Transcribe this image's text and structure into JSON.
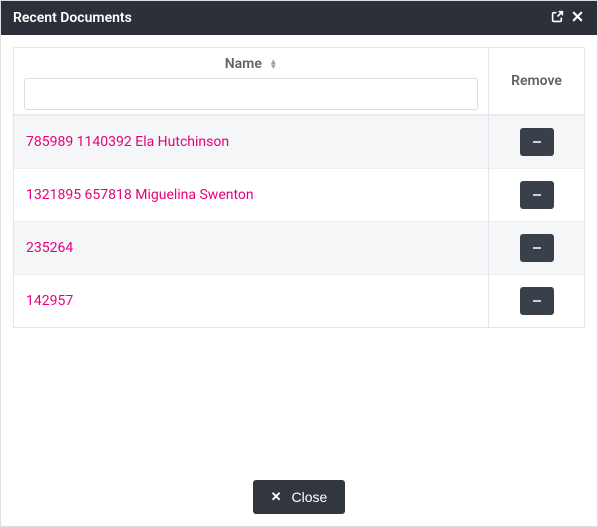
{
  "titlebar": {
    "title": "Recent Documents"
  },
  "columns": {
    "name": "Name",
    "remove": "Remove"
  },
  "filter": {
    "value": "",
    "placeholder": ""
  },
  "rows": [
    {
      "name": "785989 1140392 Ela Hutchinson"
    },
    {
      "name": "1321895 657818 Miguelina Swenton"
    },
    {
      "name": "235264"
    },
    {
      "name": "142957"
    }
  ],
  "buttons": {
    "close": "Close"
  },
  "icons": {
    "external": "external-icon",
    "close_x": "close-icon",
    "minus": "minus-icon",
    "sort": "sort-icon"
  }
}
